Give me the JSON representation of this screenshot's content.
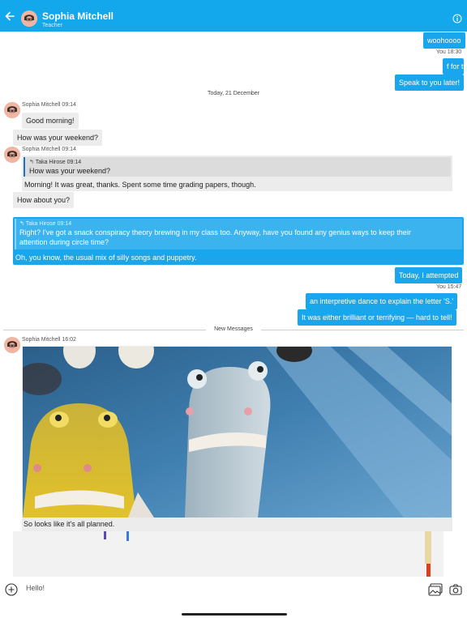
{
  "header": {
    "contact_name": "Sophia Mitchell",
    "contact_role": "Teacher",
    "colors": {
      "bar": "#13a7ec",
      "out_bubble": "#1aa6ec"
    },
    "icons": {
      "back": "back-arrow-icon",
      "info": "info-icon"
    }
  },
  "messages": {
    "m1": "woohoooo",
    "t1_sender": "You",
    "t1_time": "18:30",
    "m2": "f for th",
    "m3": "Speak to you later!",
    "date_divider": "Today, 21 December",
    "s1_name": "Sophia Mitchell",
    "s1_time": "09:14",
    "m4": "Good morning!",
    "m5": "How was your weekend?",
    "s2_name": "Sophia Mitchell",
    "s2_time": "09:14",
    "q1_name": "Taka Hirose",
    "q1_time": "09:14",
    "q1_text": "How was your weekend?",
    "m6": "Morning! It was great, thanks. Spent some time grading papers, though.",
    "m7": "How about you?",
    "q2_name": "Taka Hirose",
    "q2_time": "09:14",
    "q2_line1": "Right? I've got a snack conspiracy theory brewing in my class too. Anyway, have you found any genius ways to keep their",
    "q2_line2": "attention during circle time?",
    "m8": "Oh, you know, the usual mix of silly songs and puppetry.",
    "m9": "Today, I attempted",
    "t2_sender": "You",
    "t2_time": "15:47",
    "m10": "an interpretive dance to explain the letter 'S.'",
    "m11": "It was either brilliant or terrifying — hard to tell!",
    "new_divider": "New Messages",
    "s3_name": "Sophia Mitchell",
    "s3_time": "16:02",
    "caption": "So looks like it's all planned."
  },
  "composer": {
    "placeholder": "Hello!",
    "icons": {
      "add": "add-icon",
      "gallery": "gallery-icon",
      "camera": "camera-icon"
    }
  }
}
